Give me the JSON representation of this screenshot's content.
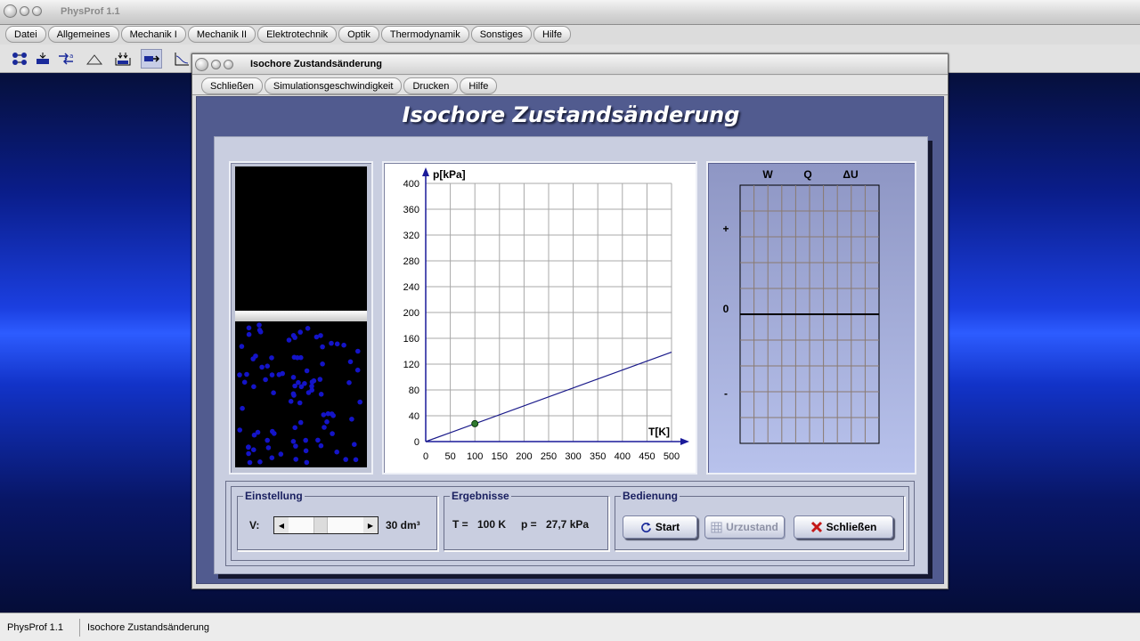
{
  "app": {
    "title": "PhysProf 1.1"
  },
  "menu": [
    "Datei",
    "Allgemeines",
    "Mechanik I",
    "Mechanik II",
    "Elektrotechnik",
    "Optik",
    "Thermodynamik",
    "Sonstiges",
    "Hilfe"
  ],
  "toolbar_icons": [
    "atoms-icon",
    "piston-icon",
    "reaction-icon",
    "wave-icon",
    "container-icon",
    "arrow-right-icon",
    "graph-icon"
  ],
  "dialog": {
    "title": "Isochore Zustandsänderung",
    "menu": [
      "Schließen",
      "Simulationsgeschwindigkeit",
      "Drucken",
      "Hilfe"
    ],
    "heading": "Isochore Zustandsänderung"
  },
  "chart_data": {
    "type": "line",
    "ylabel": "p[kPa]",
    "xlabel": "T[K]",
    "x_ticks": [
      0,
      50,
      100,
      150,
      200,
      250,
      300,
      350,
      400,
      450,
      500
    ],
    "y_ticks": [
      0,
      40,
      80,
      120,
      160,
      200,
      240,
      280,
      320,
      360,
      400
    ],
    "xlim": [
      0,
      500
    ],
    "ylim": [
      0,
      400
    ],
    "series": [
      {
        "x": [
          0,
          500
        ],
        "y": [
          0,
          138.5
        ]
      }
    ],
    "current_point": {
      "x": 100,
      "y": 27.7
    }
  },
  "energy_chart": {
    "columns": [
      "W",
      "Q",
      "ΔU"
    ],
    "y_labels": [
      "+",
      "0",
      "-"
    ]
  },
  "controls": {
    "einstellung": {
      "legend": "Einstellung",
      "label": "V:",
      "value": "30 dm³",
      "slider_fraction": 0.3
    },
    "ergebnisse": {
      "legend": "Ergebnisse",
      "t_label": "T =",
      "t_value": "100 K",
      "p_label": "p =",
      "p_value": "27,7 kPa"
    },
    "bedienung": {
      "legend": "Bedienung",
      "start": "Start",
      "urzustand": "Urzustand",
      "schliessen": "Schließen"
    }
  },
  "status": {
    "app": "PhysProf 1.1",
    "module": "Isochore Zustandsänderung"
  }
}
